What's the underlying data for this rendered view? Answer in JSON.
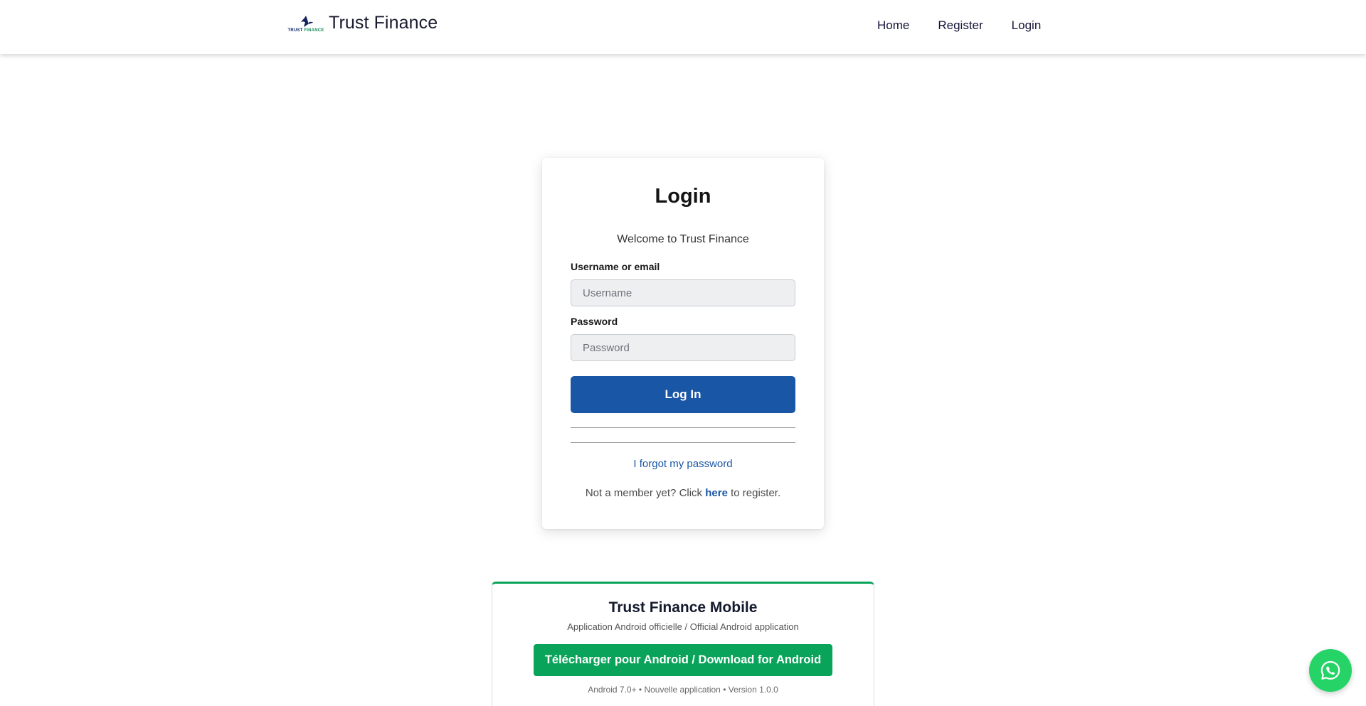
{
  "navbar": {
    "logo_text_main": "TRUST",
    "logo_text_accent": "FINANCE",
    "brand": "Trust Finance",
    "links": [
      "Home",
      "Register",
      "Login"
    ]
  },
  "login": {
    "title": "Login",
    "welcome": "Welcome to Trust Finance",
    "username_label": "Username or email",
    "username_placeholder": "Username",
    "password_label": "Password",
    "password_placeholder": "Password",
    "submit_label": "Log In",
    "forgot_link": "I forgot my password",
    "register_prefix": "Not a member yet? Click",
    "register_link": "here",
    "register_suffix": "to register."
  },
  "mobile": {
    "title": "Trust Finance Mobile",
    "subtitle": "Application Android officielle / Official Android application",
    "download_label": "Télécharger pour Android / Download for Android",
    "meta": "Android 7.0+ • Nouvelle application • Version 1.0.0"
  },
  "colors": {
    "primary": "#1a56a6",
    "accent_green": "#0aa35a",
    "whatsapp": "#25d366"
  },
  "icons": {
    "logo": "bird-logo-icon",
    "chat": "whatsapp-icon"
  }
}
